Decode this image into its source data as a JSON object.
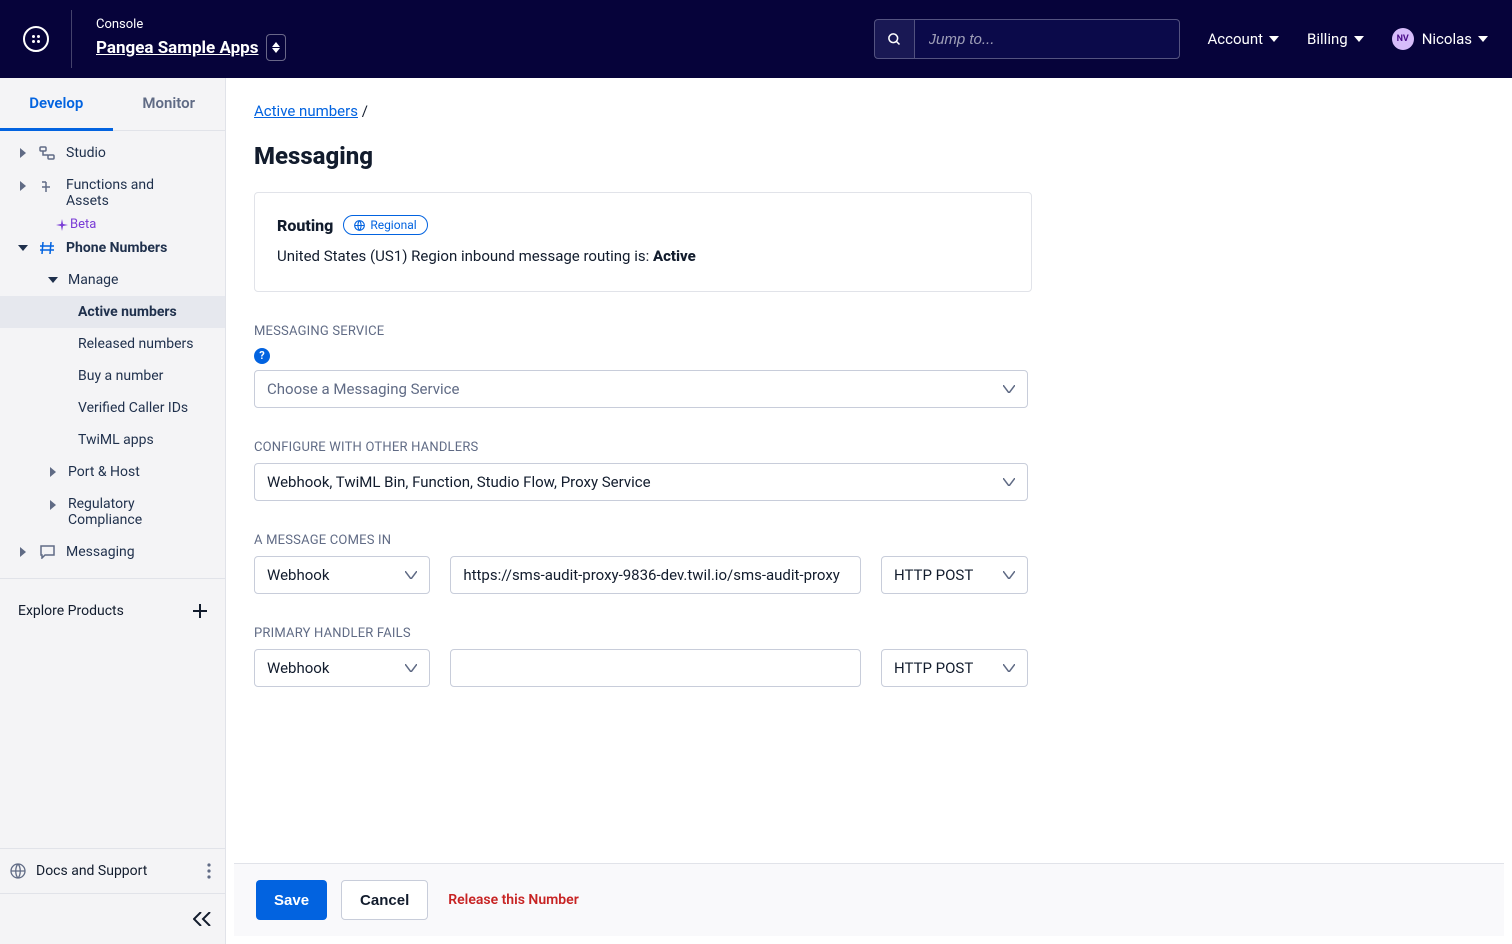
{
  "header": {
    "console_label": "Console",
    "project_name": "Pangea Sample Apps",
    "search_placeholder": "Jump to...",
    "menus": {
      "account": "Account",
      "billing": "Billing",
      "user": "Nicolas",
      "user_initials": "NV"
    }
  },
  "sidebar": {
    "tabs": {
      "develop": "Develop",
      "monitor": "Monitor"
    },
    "items": {
      "studio": "Studio",
      "functions": "Functions and Assets",
      "beta": "Beta",
      "phone_numbers": "Phone Numbers",
      "manage": "Manage",
      "active_numbers": "Active numbers",
      "released_numbers": "Released numbers",
      "buy_number": "Buy a number",
      "verified_caller": "Verified Caller IDs",
      "twiml_apps": "TwiML apps",
      "port_host": "Port & Host",
      "regulatory": "Regulatory Compliance",
      "messaging": "Messaging"
    },
    "explore": "Explore Products",
    "docs": "Docs and Support"
  },
  "breadcrumb": {
    "active_numbers": "Active numbers",
    "sep": "/"
  },
  "page": {
    "title": "Messaging",
    "routing": {
      "heading": "Routing",
      "badge": "Regional",
      "text_prefix": "United States (US1) Region inbound message routing is: ",
      "status": "Active"
    },
    "msg_service": {
      "label": "MESSAGING SERVICE",
      "placeholder": "Choose a Messaging Service"
    },
    "handlers": {
      "label": "CONFIGURE WITH OTHER HANDLERS",
      "value": "Webhook, TwiML Bin, Function, Studio Flow, Proxy Service"
    },
    "incoming": {
      "label": "A MESSAGE COMES IN",
      "type": "Webhook",
      "url": "https://sms-audit-proxy-9836-dev.twil.io/sms-audit-proxy",
      "method": "HTTP POST"
    },
    "fallback": {
      "label": "PRIMARY HANDLER FAILS",
      "type": "Webhook",
      "url": "",
      "method": "HTTP POST"
    }
  },
  "footer": {
    "save": "Save",
    "cancel": "Cancel",
    "release": "Release this Number"
  }
}
